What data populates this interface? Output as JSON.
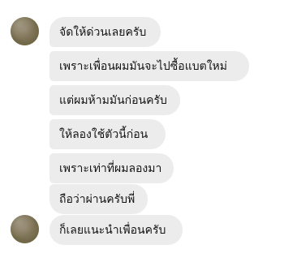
{
  "conversation": {
    "messages": [
      {
        "text": "จัดให้ด่วนเลยครับ"
      },
      {
        "text": "เพราะเพื่อนผมมันจะไปซื้อแบตใหม่"
      },
      {
        "text": "แต่ผมห้ามมันก่อนครับ"
      },
      {
        "text": "ให้ลองใช้ตัวนี้ก่อน"
      },
      {
        "text": "เพราะเท่าที่ผมลองมา"
      },
      {
        "text": "ถือว่าผ่านครับพี่"
      },
      {
        "text": "ก็เลยแนะนำเพื่อนครับ"
      }
    ]
  }
}
